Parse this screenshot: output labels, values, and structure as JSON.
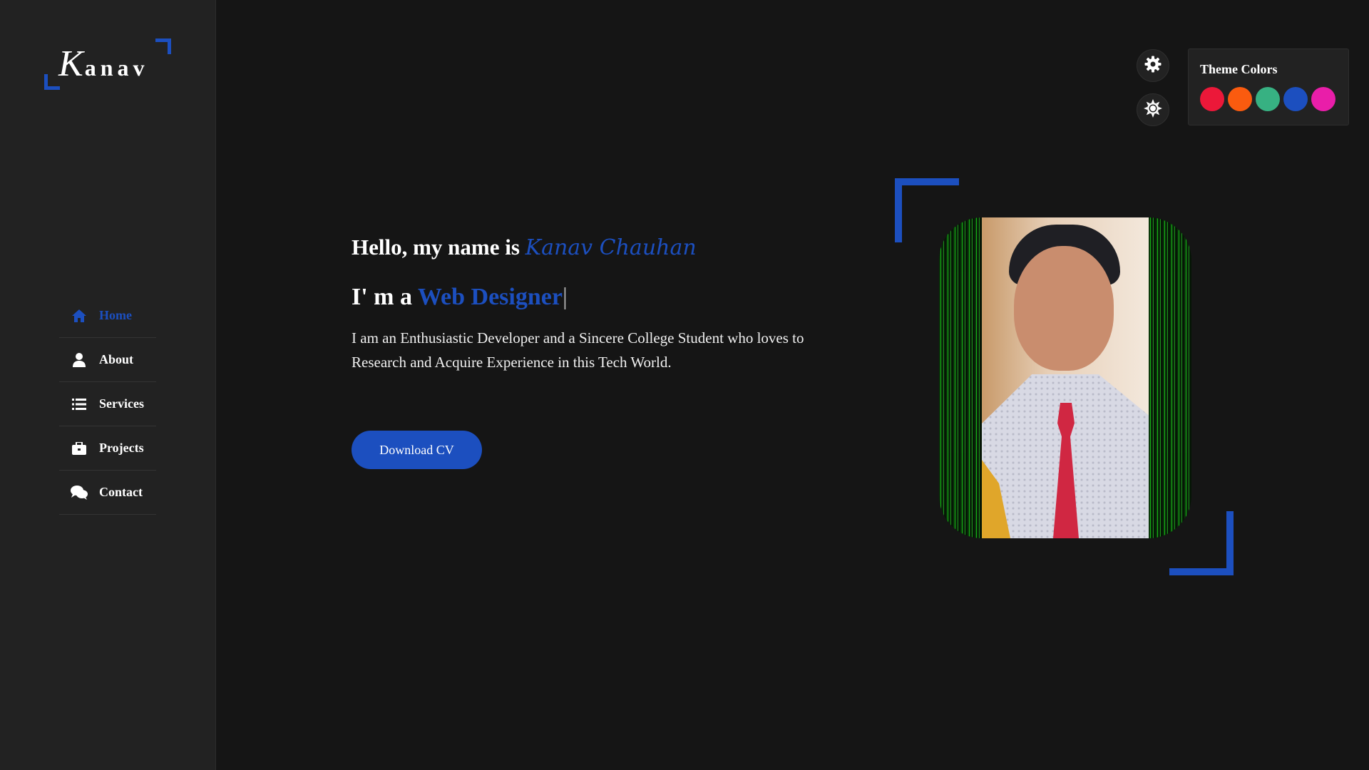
{
  "logo": {
    "initial": "K",
    "rest": "anav"
  },
  "nav": {
    "items": [
      {
        "label": "Home",
        "icon": "home-icon",
        "active": true
      },
      {
        "label": "About",
        "icon": "user-icon",
        "active": false
      },
      {
        "label": "Services",
        "icon": "list-icon",
        "active": false
      },
      {
        "label": "Projects",
        "icon": "briefcase-icon",
        "active": false
      },
      {
        "label": "Contact",
        "icon": "comments-icon",
        "active": false
      }
    ]
  },
  "hero": {
    "greeting_prefix": "Hello, my name is",
    "name": "Kanav Chauhan",
    "role_prefix": "I' m a",
    "role_word": "Web Designer",
    "cursor": "|",
    "description": "I am an Enthusiastic Developer and a Sincere College Student who loves to Research and Acquire Experience in this Tech World.",
    "cta_label": "Download CV"
  },
  "theme": {
    "title": "Theme Colors",
    "accent": "#1c4fbf",
    "swatches": [
      "#ec1839",
      "#fa5b0f",
      "#37b182",
      "#1c4fbf",
      "#e91ea9"
    ]
  }
}
